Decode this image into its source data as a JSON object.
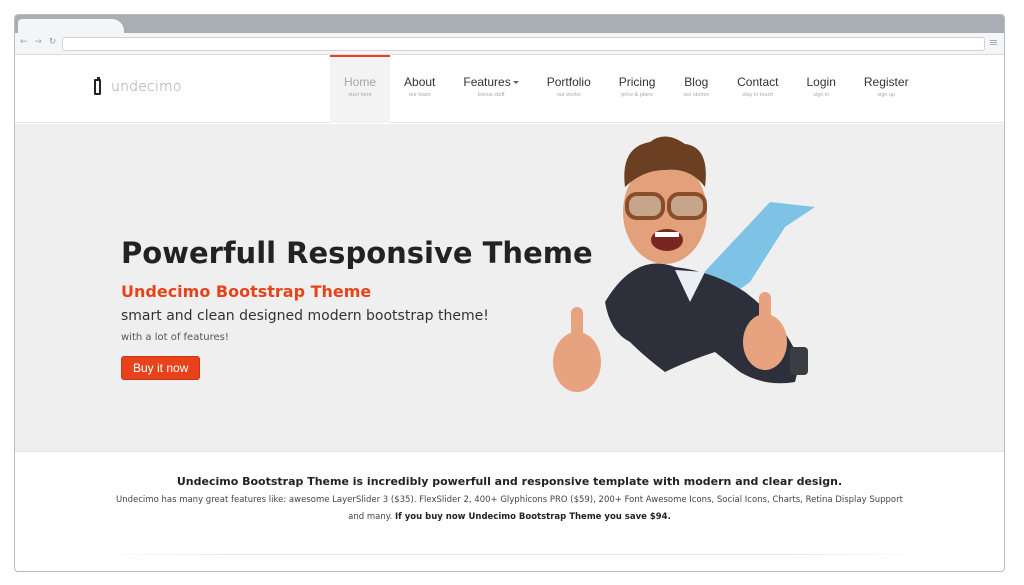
{
  "browser": {
    "nav_glyphs": "← → ↻",
    "menu_glyph": "≡"
  },
  "site": {
    "logo_text": "undecimo",
    "menu": [
      {
        "label": "Home",
        "sub": "start here",
        "active": true
      },
      {
        "label": "Features",
        "sub": "bonus stuff",
        "active": false
      },
      {
        "label": "About",
        "sub": "our team",
        "active": false
      },
      {
        "label": "Portfolio",
        "sub": "our works",
        "active": false
      },
      {
        "label": "Pricing",
        "sub": "price & plans",
        "active": false
      },
      {
        "label": "Blog",
        "sub": "our stories",
        "active": false
      },
      {
        "label": "Contact",
        "sub": "stay in touch",
        "active": false
      },
      {
        "label": "Login",
        "sub": "sign in",
        "active": false
      },
      {
        "label": "Register",
        "sub": "sign up",
        "active": false
      }
    ],
    "menu_order": {
      "home": {
        "label": "Home",
        "sub": "start here"
      },
      "about": {
        "label": "About",
        "sub": "our team"
      },
      "features": {
        "label": "Features",
        "sub": "bonus stuff"
      },
      "portfolio": {
        "label": "Portfolio",
        "sub": "our works"
      },
      "pricing": {
        "label": "Pricing",
        "sub": "price & plans"
      },
      "blog": {
        "label": "Blog",
        "sub": "our stories"
      },
      "contact": {
        "label": "Contact",
        "sub": "stay in touch"
      },
      "login": {
        "label": "Login",
        "sub": "sign in"
      },
      "register": {
        "label": "Register",
        "sub": "sign up"
      }
    }
  },
  "hero": {
    "title": "Powerfull Responsive Theme",
    "subtitle": "Undecimo Bootstrap Theme",
    "tagline": "smart and clean designed modern bootstrap theme!",
    "small": "with a lot of features!",
    "button_label": "Buy it now"
  },
  "intro": {
    "headline": "Undecimo Bootstrap Theme is incredibly powerfull and responsive template with modern and clear design.",
    "line1": "Undecimo has many great features like: awesome LayerSlider 3 ($35). FlexSlider 2, 400+ Glyphicons PRO ($59), 200+ Font Awesome Icons, Social Icons, Charts, Retina Display Support",
    "line2_plain": "and many. ",
    "line2_bold": "If you buy now Undecimo Bootstrap Theme you save $94."
  },
  "colors": {
    "accent": "#e8421a",
    "hero_bg": "#efeff0",
    "chrome": "#a9adb4"
  }
}
